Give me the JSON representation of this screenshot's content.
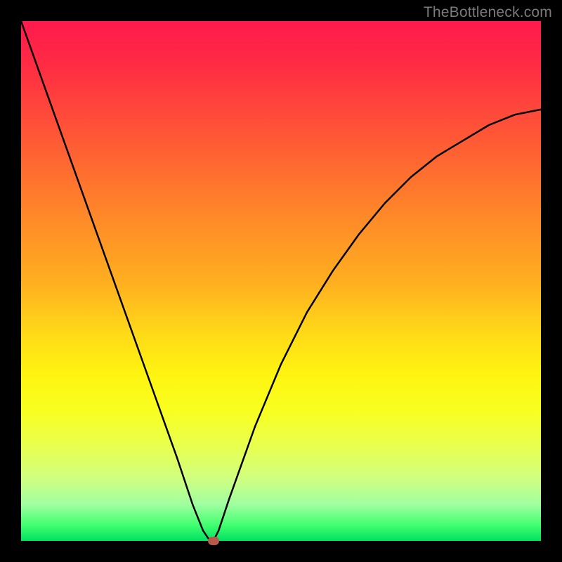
{
  "watermark": "TheBottleneck.com",
  "colors": {
    "background": "#000000",
    "curve": "#000000",
    "marker": "#b55a4a"
  },
  "chart_data": {
    "type": "line",
    "title": "",
    "xlabel": "",
    "ylabel": "",
    "xlim": [
      0,
      100
    ],
    "ylim": [
      0,
      100
    ],
    "grid": false,
    "legend": false,
    "series": [
      {
        "name": "curve",
        "x": [
          0,
          5,
          10,
          15,
          20,
          25,
          30,
          33,
          35,
          36,
          37,
          38,
          40,
          45,
          50,
          55,
          60,
          65,
          70,
          75,
          80,
          85,
          90,
          95,
          100
        ],
        "values": [
          100,
          86,
          72,
          58,
          44,
          30,
          16,
          7,
          2,
          0.5,
          0,
          2,
          8,
          22,
          34,
          44,
          52,
          59,
          65,
          70,
          74,
          77,
          80,
          82,
          83
        ]
      }
    ],
    "marker": {
      "x": 37,
      "y": 0
    },
    "background_gradient": {
      "type": "vertical",
      "stops": [
        {
          "pos": 0,
          "color": "#ff1a4d"
        },
        {
          "pos": 50,
          "color": "#ffae20"
        },
        {
          "pos": 70,
          "color": "#fff410"
        },
        {
          "pos": 100,
          "color": "#00e060"
        }
      ]
    }
  }
}
